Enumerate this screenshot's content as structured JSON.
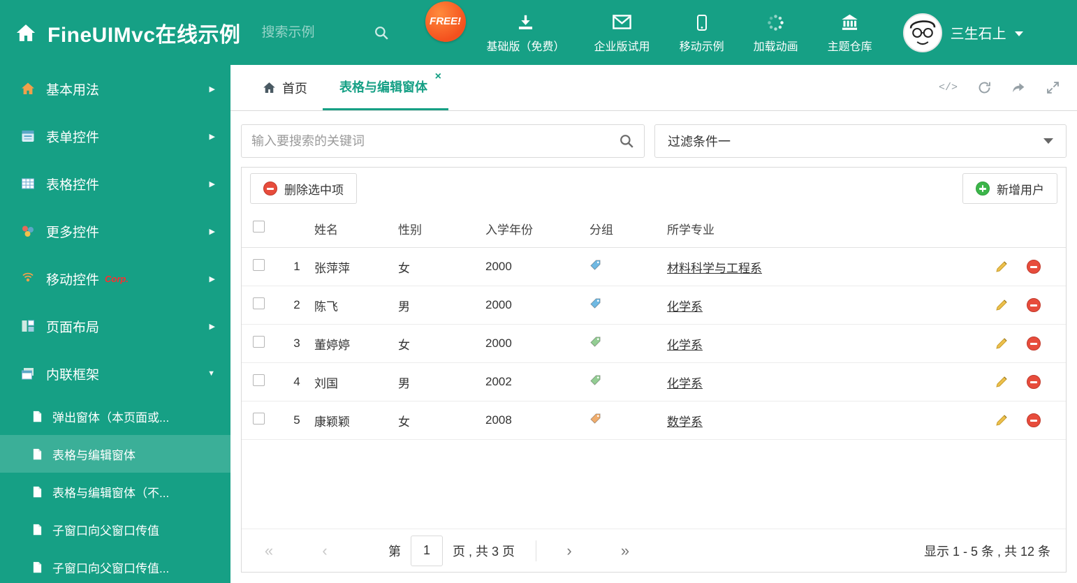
{
  "colors": {
    "primary": "#16A085",
    "delete_red": "#E74C3C",
    "add_green": "#3CB54A",
    "tag_blue": "#6FB9E3",
    "tag_green": "#93CD93",
    "tag_orange": "#F0AD6D"
  },
  "header": {
    "title": "FineUIMvc在线示例",
    "search_placeholder": "搜索示例",
    "free_badge": "FREE!",
    "actions": [
      {
        "label": "基础版（免费）"
      },
      {
        "label": "企业版试用"
      },
      {
        "label": "移动示例"
      },
      {
        "label": "加载动画"
      },
      {
        "label": "主题仓库"
      }
    ],
    "user_name": "三生石上"
  },
  "sidebar": {
    "items": [
      {
        "label": "基本用法"
      },
      {
        "label": "表单控件"
      },
      {
        "label": "表格控件"
      },
      {
        "label": "更多控件"
      },
      {
        "label": "移动控件",
        "badge": "Corp."
      },
      {
        "label": "页面布局"
      },
      {
        "label": "内联框架"
      }
    ],
    "subitems": [
      {
        "label": "弹出窗体（本页面或..."
      },
      {
        "label": "表格与编辑窗体"
      },
      {
        "label": "表格与编辑窗体（不..."
      },
      {
        "label": "子窗口向父窗口传值"
      },
      {
        "label": "子窗口向父窗口传值..."
      }
    ]
  },
  "tabs": {
    "home": "首页",
    "active": "表格与编辑窗体",
    "close_glyph": "×",
    "code_label": "</>"
  },
  "filters": {
    "search_placeholder": "输入要搜索的关键词",
    "filter_value": "过滤条件一"
  },
  "toolbar": {
    "delete_label": "删除选中项",
    "add_label": "新增用户"
  },
  "table": {
    "headers": {
      "name": "姓名",
      "gender": "性别",
      "year": "入学年份",
      "group": "分组",
      "major": "所学专业"
    },
    "rows": [
      {
        "num": "1",
        "name": "张萍萍",
        "gender": "女",
        "year": "2000",
        "tag": "blue",
        "major": "材料科学与工程系"
      },
      {
        "num": "2",
        "name": "陈飞",
        "gender": "男",
        "year": "2000",
        "tag": "blue",
        "major": "化学系"
      },
      {
        "num": "3",
        "name": "董婷婷",
        "gender": "女",
        "year": "2000",
        "tag": "green",
        "major": "化学系"
      },
      {
        "num": "4",
        "name": "刘国",
        "gender": "男",
        "year": "2002",
        "tag": "green",
        "major": "化学系"
      },
      {
        "num": "5",
        "name": "康颖颖",
        "gender": "女",
        "year": "2008",
        "tag": "orange",
        "major": "数学系"
      }
    ]
  },
  "pagination": {
    "first_glyph": "«",
    "prev_glyph": "‹",
    "next_glyph": "›",
    "last_glyph": "»",
    "label_prefix": "第",
    "page": "1",
    "label_suffix": "页 , 共 3 页",
    "summary": "显示 1 - 5 条 , 共 12 条"
  }
}
